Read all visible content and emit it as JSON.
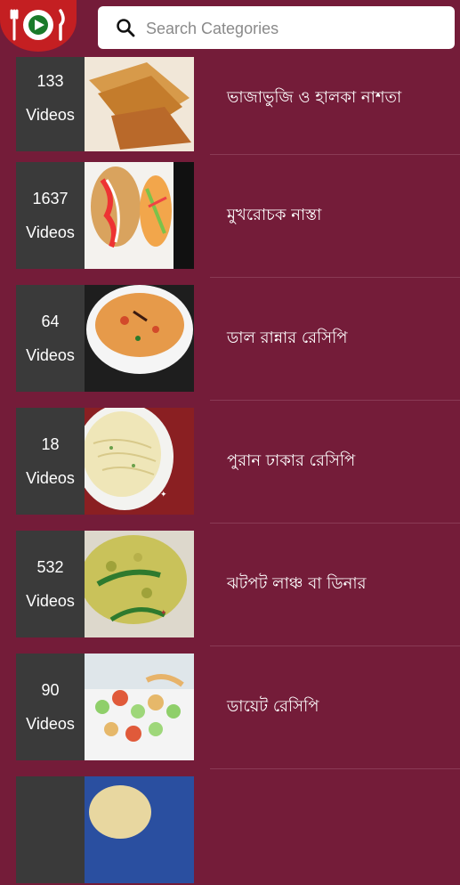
{
  "header": {
    "logo_icon": "plate-fork-knife-icon",
    "search_placeholder": "Search Categories",
    "search_icon": "search-icon"
  },
  "categories": [
    {
      "count": "133",
      "unit": "Videos",
      "title": "ভাজাভুজি ও হালকা নাশতা"
    },
    {
      "count": "1637",
      "unit": "Videos",
      "title": "মুখরোচক নাস্তা"
    },
    {
      "count": "64",
      "unit": "Videos",
      "title": "ডাল রান্নার রেসিপি"
    },
    {
      "count": "18",
      "unit": "Videos",
      "title": "পুরান ঢাকার রেসিপি"
    },
    {
      "count": "532",
      "unit": "Videos",
      "title": "ঝটপট লাঞ্চ বা ডিনার"
    },
    {
      "count": "90",
      "unit": "Videos",
      "title": "ডায়েট রেসিপি"
    }
  ]
}
